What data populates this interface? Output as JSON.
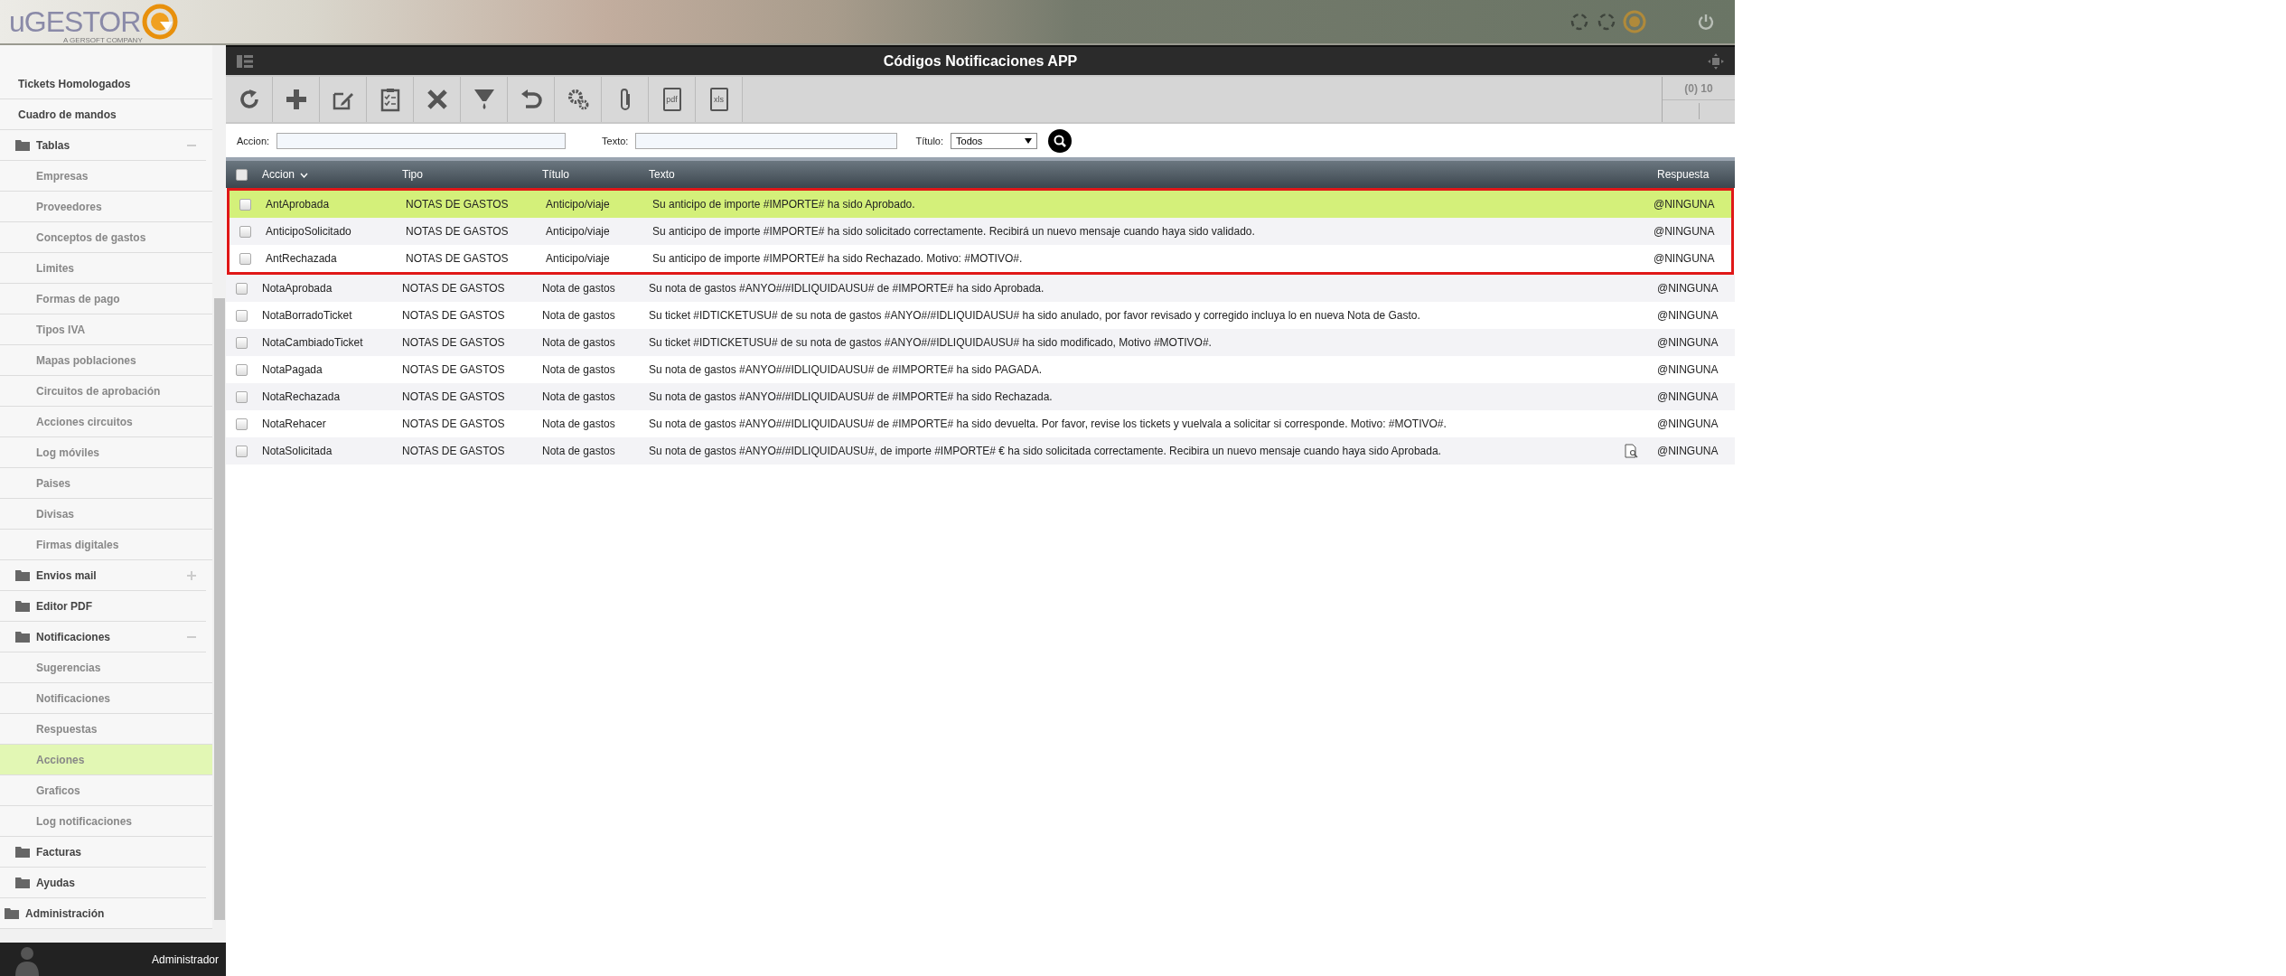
{
  "header": {
    "logo": "uGESTOR",
    "logo_tagline": "A GERSOFT COMPANY"
  },
  "sidebar": {
    "items": [
      {
        "kind": "link",
        "label": "Tickets Homologados",
        "selected": false
      },
      {
        "kind": "link",
        "label": "Cuadro de mandos",
        "selected": false
      },
      {
        "kind": "folder",
        "label": "Tablas",
        "expanded": true,
        "selected": false,
        "children": [
          {
            "label": "Empresas",
            "selected": false
          },
          {
            "label": "Proveedores",
            "selected": false
          },
          {
            "label": "Conceptos de gastos",
            "selected": false
          },
          {
            "label": "Limites",
            "selected": false
          },
          {
            "label": "Formas de pago",
            "selected": false
          },
          {
            "label": "Tipos IVA",
            "selected": false
          },
          {
            "label": "Mapas poblaciones",
            "selected": false
          },
          {
            "label": "Circuitos de aprobación",
            "selected": false
          },
          {
            "label": "Acciones circuitos",
            "selected": false
          },
          {
            "label": "Log móviles",
            "selected": false
          },
          {
            "label": "Paises",
            "selected": false
          },
          {
            "label": "Divisas",
            "selected": false
          },
          {
            "label": "Firmas digitales",
            "selected": false
          }
        ]
      },
      {
        "kind": "folder",
        "label": "Envios mail",
        "expanded": false,
        "selected": false
      },
      {
        "kind": "folder",
        "label": "Editor PDF",
        "selected": false
      },
      {
        "kind": "folder",
        "label": "Notificaciones",
        "expanded": true,
        "selected": false,
        "children": [
          {
            "label": "Sugerencias",
            "selected": false
          },
          {
            "label": "Notificaciones",
            "selected": false
          },
          {
            "label": "Respuestas",
            "selected": false
          },
          {
            "label": "Acciones",
            "selected": true
          },
          {
            "label": "Graficos",
            "selected": false
          },
          {
            "label": "Log notificaciones",
            "selected": false
          }
        ]
      },
      {
        "kind": "folder",
        "label": "Facturas",
        "selected": false
      },
      {
        "kind": "folder",
        "label": "Ayudas",
        "selected": false
      },
      {
        "kind": "root-folder",
        "label": "Administración",
        "selected": false
      }
    ],
    "user": "Administrador"
  },
  "panel": {
    "title": "Códigos Notificaciones APP",
    "toolbar": [
      {
        "kind": "refresh"
      },
      {
        "kind": "add"
      },
      {
        "kind": "edit"
      },
      {
        "kind": "checklist"
      },
      {
        "kind": "delete"
      },
      {
        "kind": "filter"
      },
      {
        "kind": "undo"
      },
      {
        "kind": "settings"
      },
      {
        "kind": "attach"
      },
      {
        "kind": "doc",
        "label": "pdf"
      },
      {
        "kind": "doc",
        "label": "xls"
      }
    ],
    "pager": "(0) 10",
    "filters": {
      "accion_label": "Accion:",
      "texto_label": "Texto:",
      "titulo_label": "Título:",
      "titulo_value": "Todos"
    }
  },
  "table": {
    "all_checked": false,
    "columns": [
      {
        "label": "Accion",
        "sorted": true
      },
      {
        "label": "Tipo",
        "sorted": false
      },
      {
        "label": "Título",
        "sorted": false
      },
      {
        "label": "Texto",
        "sorted": false
      },
      {
        "label": "Respuesta",
        "sorted": false
      }
    ],
    "rows": [
      {
        "accion": "AntAprobada",
        "tipo": "NOTAS DE GASTOS",
        "titulo": "Anticipo/viaje",
        "texto": "Su anticipo de importe #IMPORTE# ha sido Aprobado.",
        "respuesta": "@NINGUNA",
        "selected": true,
        "outlined": true,
        "preview": false
      },
      {
        "accion": "AnticipoSolicitado",
        "tipo": "NOTAS DE GASTOS",
        "titulo": "Anticipo/viaje",
        "texto": "Su anticipo de importe #IMPORTE# ha sido solicitado correctamente. Recibirá un nuevo mensaje cuando haya sido validado.",
        "respuesta": "@NINGUNA",
        "selected": false,
        "outlined": true,
        "preview": false
      },
      {
        "accion": "AntRechazada",
        "tipo": "NOTAS DE GASTOS",
        "titulo": "Anticipo/viaje",
        "texto": "Su anticipo de importe #IMPORTE# ha sido Rechazado. Motivo: #MOTIVO#.",
        "respuesta": "@NINGUNA",
        "selected": false,
        "outlined": true,
        "preview": false
      },
      {
        "accion": "NotaAprobada",
        "tipo": "NOTAS DE GASTOS",
        "titulo": "Nota de gastos",
        "texto": "Su nota de gastos #ANYO#/#IDLIQUIDAUSU# de #IMPORTE# ha sido Aprobada.",
        "respuesta": "@NINGUNA",
        "selected": false,
        "outlined": false,
        "preview": false
      },
      {
        "accion": "NotaBorradoTicket",
        "tipo": "NOTAS DE GASTOS",
        "titulo": "Nota de gastos",
        "texto": "Su ticket #IDTICKETUSU# de su nota de gastos #ANYO#/#IDLIQUIDAUSU# ha sido anulado, por favor revisado y corregido incluya lo en nueva Nota de Gasto.",
        "respuesta": "@NINGUNA",
        "selected": false,
        "outlined": false,
        "preview": false
      },
      {
        "accion": "NotaCambiadoTicket",
        "tipo": "NOTAS DE GASTOS",
        "titulo": "Nota de gastos",
        "texto": "Su ticket #IDTICKETUSU# de su nota de gastos #ANYO#/#IDLIQUIDAUSU# ha sido modificado, Motivo #MOTIVO#.",
        "respuesta": "@NINGUNA",
        "selected": false,
        "outlined": false,
        "preview": false
      },
      {
        "accion": "NotaPagada",
        "tipo": "NOTAS DE GASTOS",
        "titulo": "Nota de gastos",
        "texto": "Su nota de gastos #ANYO#/#IDLIQUIDAUSU# de #IMPORTE# ha sido PAGADA.",
        "respuesta": "@NINGUNA",
        "selected": false,
        "outlined": false,
        "preview": false
      },
      {
        "accion": "NotaRechazada",
        "tipo": "NOTAS DE GASTOS",
        "titulo": "Nota de gastos",
        "texto": "Su nota de gastos #ANYO#/#IDLIQUIDAUSU# de #IMPORTE# ha sido Rechazada.",
        "respuesta": "@NINGUNA",
        "selected": false,
        "outlined": false,
        "preview": false
      },
      {
        "accion": "NotaRehacer",
        "tipo": "NOTAS DE GASTOS",
        "titulo": "Nota de gastos",
        "texto": "Su nota de gastos #ANYO#/#IDLIQUIDAUSU# de #IMPORTE# ha sido devuelta. Por favor, revise los tickets y vuelvala a solicitar si corresponde. Motivo: #MOTIVO#.",
        "respuesta": "@NINGUNA",
        "selected": false,
        "outlined": false,
        "preview": false
      },
      {
        "accion": "NotaSolicitada",
        "tipo": "NOTAS DE GASTOS",
        "titulo": "Nota de gastos",
        "texto": "Su nota de gastos #ANYO#/#IDLIQUIDAUSU#, de importe #IMPORTE# € ha sido solicitada correctamente. Recibira un nuevo mensaje cuando haya sido Aprobada.",
        "respuesta": "@NINGUNA",
        "selected": false,
        "outlined": false,
        "preview": true
      }
    ]
  }
}
